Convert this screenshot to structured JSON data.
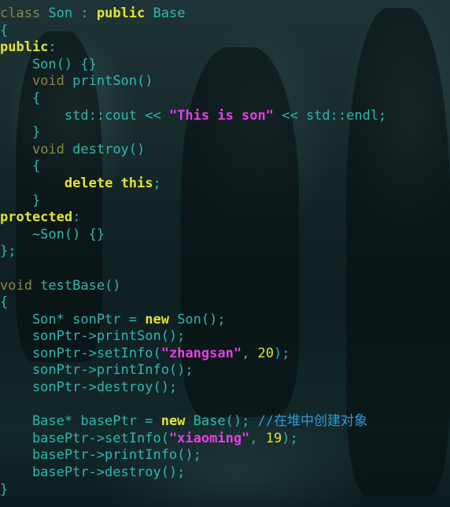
{
  "lines": [
    [
      [
        "type",
        "class"
      ],
      [
        "ident",
        " Son : "
      ],
      [
        "kw",
        "public"
      ],
      [
        "ident",
        " Base"
      ]
    ],
    [
      [
        "pun",
        "{"
      ]
    ],
    [
      [
        "kw",
        "public"
      ],
      [
        "pun",
        ":"
      ]
    ],
    [
      [
        "ident",
        "    Son() {}"
      ]
    ],
    [
      [
        "ident",
        "    "
      ],
      [
        "type",
        "void"
      ],
      [
        "ident",
        " printSon()"
      ]
    ],
    [
      [
        "pun",
        "    {"
      ]
    ],
    [
      [
        "ident",
        "        std::cout << "
      ],
      [
        "str",
        "\"This is son\""
      ],
      [
        "ident",
        " << std::endl;"
      ]
    ],
    [
      [
        "pun",
        "    }"
      ]
    ],
    [
      [
        "ident",
        "    "
      ],
      [
        "type",
        "void"
      ],
      [
        "ident",
        " destroy()"
      ]
    ],
    [
      [
        "pun",
        "    {"
      ]
    ],
    [
      [
        "ident",
        "        "
      ],
      [
        "kw",
        "delete"
      ],
      [
        "ident",
        " "
      ],
      [
        "kw",
        "this"
      ],
      [
        "ident",
        ";"
      ]
    ],
    [
      [
        "pun",
        "    }"
      ]
    ],
    [
      [
        "kw",
        "protected"
      ],
      [
        "pun",
        ":"
      ]
    ],
    [
      [
        "ident",
        "    ~Son() {}"
      ]
    ],
    [
      [
        "pun",
        "};"
      ]
    ],
    [
      [
        "ident",
        ""
      ]
    ],
    [
      [
        "type",
        "void"
      ],
      [
        "ident",
        " testBase()"
      ]
    ],
    [
      [
        "pun",
        "{"
      ]
    ],
    [
      [
        "ident",
        "    Son* sonPtr = "
      ],
      [
        "kw",
        "new"
      ],
      [
        "ident",
        " Son();"
      ]
    ],
    [
      [
        "ident",
        "    sonPtr->printSon();"
      ]
    ],
    [
      [
        "ident",
        "    sonPtr->setInfo("
      ],
      [
        "str",
        "\"zhangsan\""
      ],
      [
        "ident",
        ", "
      ],
      [
        "num",
        "20"
      ],
      [
        "ident",
        ");"
      ]
    ],
    [
      [
        "ident",
        "    sonPtr->printInfo();"
      ]
    ],
    [
      [
        "ident",
        "    sonPtr->destroy();"
      ]
    ],
    [
      [
        "ident",
        ""
      ]
    ],
    [
      [
        "ident",
        "    Base* basePtr = "
      ],
      [
        "kw",
        "new"
      ],
      [
        "ident",
        " Base(); "
      ],
      [
        "cmt",
        "//在堆中创建对象"
      ]
    ],
    [
      [
        "ident",
        "    basePtr->setInfo("
      ],
      [
        "str",
        "\"xiaoming\""
      ],
      [
        "ident",
        ", "
      ],
      [
        "num",
        "19"
      ],
      [
        "ident",
        ");"
      ]
    ],
    [
      [
        "ident",
        "    basePtr->printInfo();"
      ]
    ],
    [
      [
        "ident",
        "    basePtr->destroy();"
      ]
    ],
    [
      [
        "pun",
        "}"
      ]
    ]
  ],
  "colors": {
    "keyword": "#e3e33a",
    "type": "#86864a",
    "identifier": "#2fb8b0",
    "string": "#e83ee6",
    "number": "#e3e33a",
    "comment": "#2e9ed8"
  }
}
